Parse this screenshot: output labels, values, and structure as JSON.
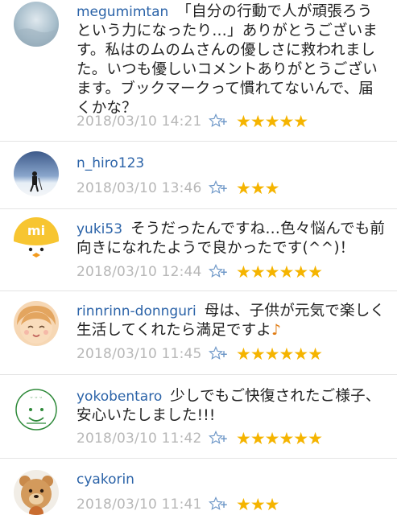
{
  "comments": [
    {
      "username": "megumimtan",
      "text": "「自分の行動で人が頑張ろうという力になったり…」ありがとうございます。私はのムのムさんの優しさに救われました。いつも優しいコメントありがとうございます。ブックマークって慣れてないんで、届くかな？",
      "note": "",
      "timestamp": "2018/03/10 14:21",
      "stars": "★★★★★",
      "avatar": "sky-avatar"
    },
    {
      "username": "n_hiro123",
      "text": "",
      "note": "",
      "timestamp": "2018/03/10 13:46",
      "stars": "★★★",
      "avatar": "snow-hiker-avatar"
    },
    {
      "username": "yuki53",
      "text": "そうだったんですね…色々悩んでも前向きになれたようで良かったです(^^)！",
      "note": "",
      "timestamp": "2018/03/10 12:44",
      "stars": "★★★★★★",
      "avatar": "mi-bird-avatar"
    },
    {
      "username": "rinnrinn-donnguri",
      "text": "母は、子供が元気で楽しく生活してくれたら満足ですよ",
      "note": "♪",
      "timestamp": "2018/03/10 11:45",
      "stars": "★★★★★★",
      "avatar": "girl-face-avatar"
    },
    {
      "username": "yokobentaro",
      "text": "少しでもご快復されたご様子、安心いたしました!!!",
      "note": "",
      "timestamp": "2018/03/10 11:42",
      "stars": "★★★★★★",
      "avatar": "stamp-face-avatar"
    },
    {
      "username": "cyakorin",
      "text": "",
      "note": "",
      "timestamp": "2018/03/10 11:41",
      "stars": "★★★",
      "avatar": "teddy-bear-avatar"
    }
  ],
  "colors": {
    "username": "#2b63a8",
    "timestamp": "#b7b7b7",
    "star": "#f5b400",
    "add_star_icon": "#6f98c8"
  }
}
